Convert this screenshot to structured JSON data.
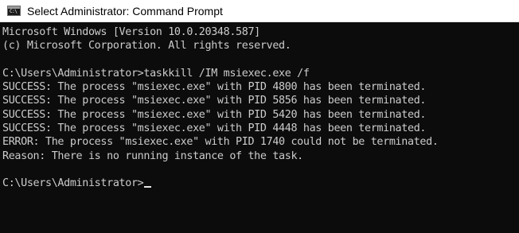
{
  "window": {
    "title": "Select Administrator: Command Prompt",
    "icon_name": "command-prompt-icon",
    "icon_glyph": "C:\\"
  },
  "console": {
    "lines": [
      "Microsoft Windows [Version 10.0.20348.587]",
      "(c) Microsoft Corporation. All rights reserved.",
      "",
      "C:\\Users\\Administrator>taskkill /IM msiexec.exe /f",
      "SUCCESS: The process \"msiexec.exe\" with PID 4800 has been terminated.",
      "SUCCESS: The process \"msiexec.exe\" with PID 5856 has been terminated.",
      "SUCCESS: The process \"msiexec.exe\" with PID 5420 has been terminated.",
      "SUCCESS: The process \"msiexec.exe\" with PID 4448 has been terminated.",
      "ERROR: The process \"msiexec.exe\" with PID 1740 could not be terminated.",
      "Reason: There is no running instance of the task.",
      ""
    ],
    "prompt": "C:\\Users\\Administrator>",
    "colors": {
      "background": "#0c0c0c",
      "text": "#cccccc"
    }
  }
}
